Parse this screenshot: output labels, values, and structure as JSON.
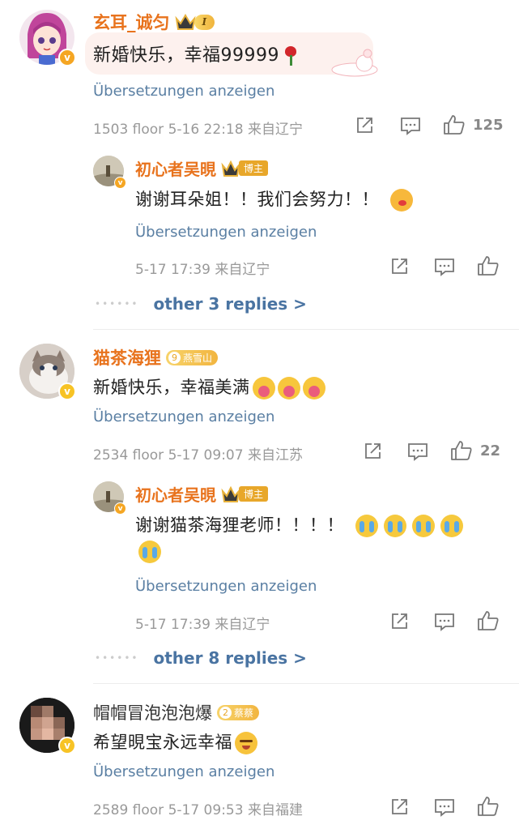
{
  "comments": [
    {
      "username": "玄耳_诚匀",
      "level": "I",
      "text": "新婚快乐，幸福99999",
      "translate": "Übersetzungen anzeigen",
      "meta": "1503 floor  5-16 22:18  来自辽宁",
      "likes": "125",
      "reply": {
        "username": "初心者吴晛",
        "tag": "博主",
        "text": "谢谢耳朵姐！！我们会努力！！",
        "translate": "Übersetzungen anzeigen",
        "meta": "5-17 17:39  来自辽宁"
      },
      "more_replies": "other 3 replies >"
    },
    {
      "username": "猫茶海狸",
      "level": "9",
      "fan_tag": "燕雪山",
      "text": "新婚快乐，幸福美满",
      "translate": "Übersetzungen anzeigen",
      "meta": "2534 floor  5-17 09:07  来自江苏",
      "likes": "22",
      "reply": {
        "username": "初心者吴晛",
        "tag": "博主",
        "text": "谢谢猫茶海狸老师！！！！",
        "translate": "Übersetzungen anzeigen",
        "meta": "5-17 17:39  来自辽宁"
      },
      "more_replies": "other 8 replies >"
    },
    {
      "username": "帽帽冒泡泡泡爆",
      "level": "2",
      "fan_tag": "蔡蔡",
      "text": "希望晛宝永远幸福",
      "translate": "Übersetzungen anzeigen",
      "meta": "2589 floor  5-17 09:53  来自福建"
    }
  ],
  "icons": {
    "share": "share-icon",
    "comment": "comment-icon",
    "like": "thumbs-up-icon"
  },
  "colors": {
    "username_orange": "#e8731d",
    "link_blue": "#5a7fa3",
    "meta_gray": "#999999",
    "gold_badge": "#e8a72a"
  }
}
